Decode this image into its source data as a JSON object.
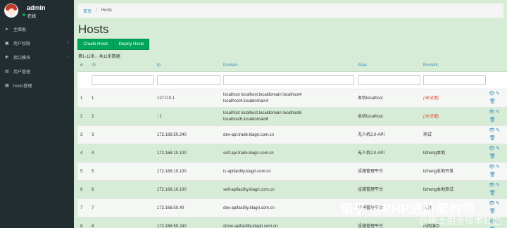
{
  "user": {
    "name": "admin",
    "status": "在线"
  },
  "sidebar": {
    "items": [
      {
        "icon": "send-icon",
        "glyph": "➤",
        "label": "主面板",
        "chevron": ""
      },
      {
        "icon": "folder-icon",
        "glyph": "▣",
        "label": "用户权限",
        "chevron": "‹"
      },
      {
        "icon": "plugin-icon",
        "glyph": "✚",
        "label": "接口模块",
        "chevron": "‹"
      },
      {
        "icon": "user-icon",
        "glyph": "▤",
        "label": "用户管理",
        "chevron": ""
      },
      {
        "icon": "hosts-icon",
        "glyph": "▦",
        "label": "hosts管理",
        "chevron": ""
      }
    ]
  },
  "breadcrumb": {
    "home": "首页",
    "separator": "/",
    "current": "Hosts"
  },
  "page": {
    "title": "Hosts",
    "summary": "第1-11条，共11条数据"
  },
  "buttons": {
    "create": "Create Hosts",
    "deploy": "Deploy Hosts"
  },
  "table": {
    "headers": {
      "num": "#",
      "id": "ID",
      "ip": "Ip",
      "domain": "Domain",
      "alias": "Alias",
      "remark": "Remark"
    },
    "rows": [
      {
        "num": "1",
        "id": "1",
        "ip": "127.0.0.1",
        "domain1": "localhost localhost.localdomain localhost4",
        "domain2": "localhost4.localdomain4",
        "alias": "本机localhost",
        "remark": "(未设置)",
        "remark_missing": true
      },
      {
        "num": "2",
        "id": "2",
        "ip": "::1",
        "domain1": "localhost localhost.localdomain localhost6",
        "domain2": "localhost6.localdomain6",
        "alias": "本机localhost",
        "remark": "(未设置)",
        "remark_missing": true
      },
      {
        "num": "3",
        "id": "3",
        "ip": "172.168.50.240",
        "domain1": "dev-api.trade.klagri.com.cn",
        "domain2": "",
        "alias": "无人机2.0-API",
        "remark": "测试",
        "remark_missing": false
      },
      {
        "num": "4",
        "id": "4",
        "ip": "172.168.10.100",
        "domain1": "self-api.trade.klagri.com.cn",
        "domain2": "",
        "alias": "无人机2.0-API",
        "remark": "lizheng本地",
        "remark_missing": false
      },
      {
        "num": "5",
        "id": "5",
        "ip": "172.168.10.100",
        "domain1": "iz-apifacility.klagri.com.cn",
        "domain2": "",
        "alias": "设施管理平台",
        "remark": "lizheng本地开发",
        "remark_missing": false
      },
      {
        "num": "6",
        "id": "6",
        "ip": "172.168.10.100",
        "domain1": "self-apifacility.klagri.com.cn",
        "domain2": "",
        "alias": "设施管理平台",
        "remark": "lizheng本地测试",
        "remark_missing": false
      },
      {
        "num": "7",
        "id": "7",
        "ip": "172.168.50.40",
        "domain1": "dev-apifacility.klagri.com.cn",
        "domain2": "",
        "alias": "设施管理平台",
        "remark": "开发",
        "remark_missing": false
      },
      {
        "num": "8",
        "id": "8",
        "ip": "172.168.50.240",
        "domain1": "show-apifacility.klagri.com.cn",
        "domain2": "",
        "alias": "设施管理平台",
        "remark": "内网演示",
        "remark_missing": false
      }
    ]
  },
  "watermark": {
    "line1": "知乎 @PHP进阶架构师",
    "line2": "@稀土掘金技术社区"
  },
  "colors": {
    "sidebar_bg": "#222d32",
    "primary_btn": "#00a65a",
    "link": "#3c8dbc",
    "missing": "#dd4b39"
  }
}
